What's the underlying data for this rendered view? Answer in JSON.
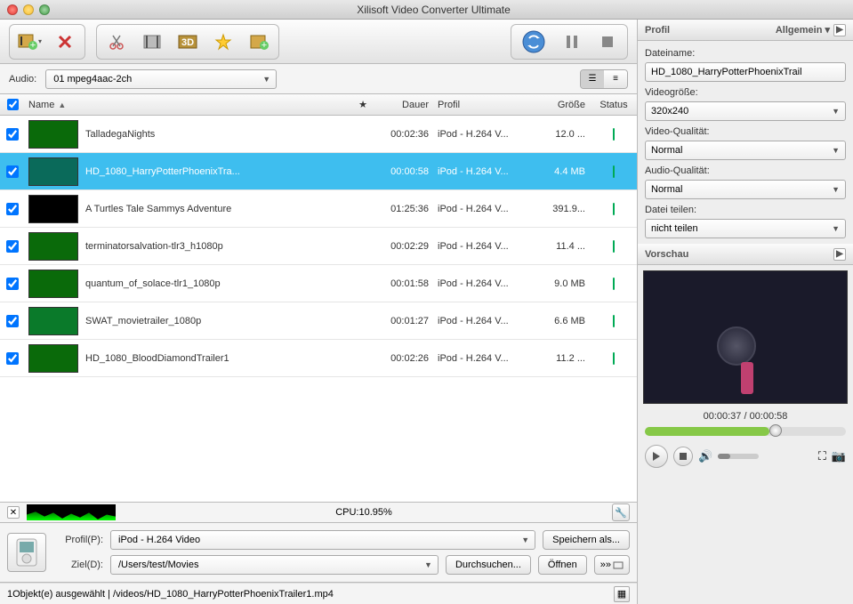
{
  "window": {
    "title": "Xilisoft Video Converter Ultimate"
  },
  "audio": {
    "label": "Audio:",
    "value": "01 mpeg4aac-2ch"
  },
  "columns": {
    "name": "Name",
    "dauer": "Dauer",
    "profil": "Profil",
    "groesse": "Größe",
    "status": "Status"
  },
  "rows": [
    {
      "name": "TalladegaNights",
      "dauer": "00:02:36",
      "profil": "iPod - H.264 V...",
      "groesse": "12.0 ...",
      "sel": false,
      "thumb": "#0a6a0a"
    },
    {
      "name": "HD_1080_HarryPotterPhoenixTra...",
      "dauer": "00:00:58",
      "profil": "iPod - H.264 V...",
      "groesse": "4.4 MB",
      "sel": true,
      "thumb": "#0a6a5a"
    },
    {
      "name": "A Turtles Tale Sammys Adventure",
      "dauer": "01:25:36",
      "profil": "iPod - H.264 V...",
      "groesse": "391.9...",
      "sel": false,
      "thumb": "#000000"
    },
    {
      "name": "terminatorsalvation-tlr3_h1080p",
      "dauer": "00:02:29",
      "profil": "iPod - H.264 V...",
      "groesse": "11.4 ...",
      "sel": false,
      "thumb": "#0a6a0a"
    },
    {
      "name": "quantum_of_solace-tlr1_1080p",
      "dauer": "00:01:58",
      "profil": "iPod - H.264 V...",
      "groesse": "9.0 MB",
      "sel": false,
      "thumb": "#0a6a0a"
    },
    {
      "name": "SWAT_movietrailer_1080p",
      "dauer": "00:01:27",
      "profil": "iPod - H.264 V...",
      "groesse": "6.6 MB",
      "sel": false,
      "thumb": "#0a7a2a"
    },
    {
      "name": "HD_1080_BloodDiamondTrailer1",
      "dauer": "00:02:26",
      "profil": "iPod - H.264 V...",
      "groesse": "11.2 ...",
      "sel": false,
      "thumb": "#0a6a0a"
    }
  ],
  "cpu": {
    "label": "CPU:10.95%"
  },
  "bottom": {
    "profil_label": "Profil(P):",
    "profil_value": "iPod - H.264 Video",
    "ziel_label": "Ziel(D):",
    "ziel_value": "/Users/test/Movies",
    "speichern": "Speichern als...",
    "durchsuchen": "Durchsuchen...",
    "oeffnen": "Öffnen",
    "jump": "»»"
  },
  "status": {
    "text": "1Objekt(e) ausgewählt | /videos/HD_1080_HarryPotterPhoenixTrailer1.mp4"
  },
  "side": {
    "profil_hdr": "Profil",
    "allgemein": "Allgemein",
    "dateiname_lbl": "Dateiname:",
    "dateiname": "HD_1080_HarryPotterPhoenixTrail",
    "videogroesse_lbl": "Videogröße:",
    "videogroesse": "320x240",
    "videoqual_lbl": "Video-Qualität:",
    "videoqual": "Normal",
    "audioqual_lbl": "Audio-Qualität:",
    "audioqual": "Normal",
    "dateiteilen_lbl": "Datei teilen:",
    "dateiteilen": "nicht teilen",
    "vorschau_hdr": "Vorschau",
    "time": "00:00:37 / 00:00:58"
  }
}
